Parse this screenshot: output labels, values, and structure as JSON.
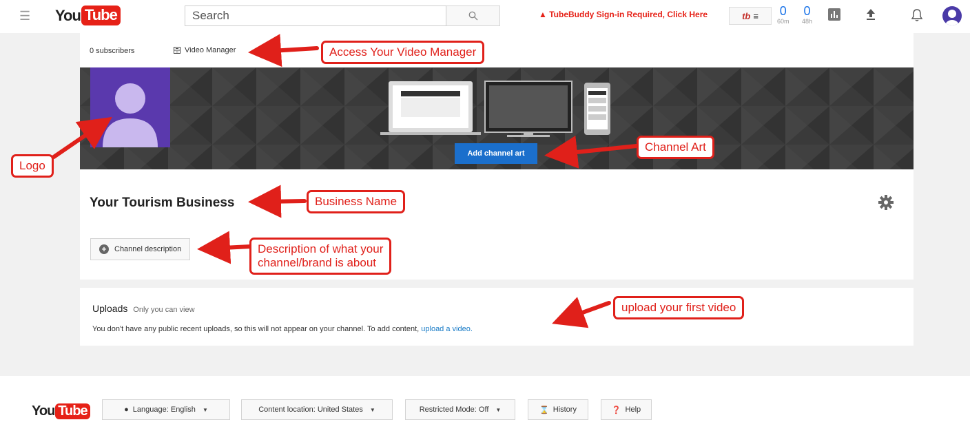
{
  "header": {
    "logo_you": "You",
    "logo_tube": "Tube",
    "search_placeholder": "Search",
    "tubebuddy_warning": "TubeBuddy Sign-in Required, Click Here",
    "tubebuddy_button": "tb",
    "stats": [
      {
        "value": "0",
        "label": "60m"
      },
      {
        "value": "0",
        "label": "48h"
      }
    ]
  },
  "channel": {
    "subscribers": "0 subscribers",
    "video_manager_label": "Video Manager",
    "add_channel_art_label": "Add channel art",
    "business_name": "Your Tourism Business",
    "channel_description_label": "Channel description"
  },
  "uploads": {
    "title": "Uploads",
    "note": "Only you can view",
    "message": "You don't have any public recent uploads, so this will not appear on your channel. To add content, ",
    "link": "upload a video."
  },
  "footer": {
    "logo_you": "You",
    "logo_tube": "Tube",
    "language": "Language: English",
    "content_location": "Content location: United States",
    "restricted_mode": "Restricted Mode: Off",
    "history": "History",
    "help": "Help"
  },
  "annotations": {
    "video_manager": "Access Your Video Manager",
    "logo": "Logo",
    "channel_art": "Channel Art",
    "business_name": "Business Name",
    "description_line1": "Description of what your",
    "description_line2": "channel/brand is about",
    "upload": "upload your first video"
  },
  "colors": {
    "annotation_red": "#e0201a",
    "youtube_red": "#e62117",
    "link_blue": "#167ac6",
    "button_blue": "#1b6fcc",
    "avatar_purple": "#5a39ad"
  }
}
